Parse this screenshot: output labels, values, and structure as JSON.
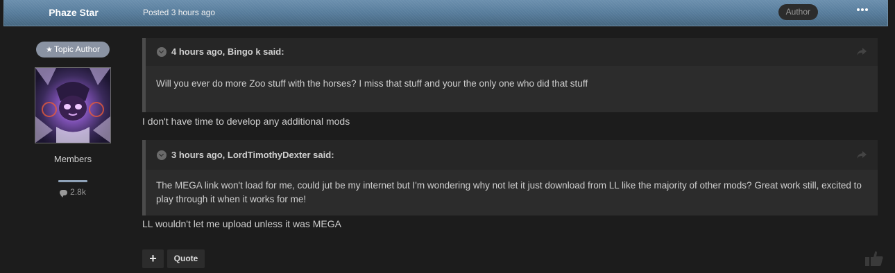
{
  "header": {
    "author_name": "Phaze Star",
    "posted": "Posted 3 hours ago",
    "author_badge": "Author",
    "more_icon": "ellipsis-icon"
  },
  "sidebar": {
    "topic_author_badge": "Topic Author",
    "badge_icon": "star-icon",
    "avatar_icon": "avatar-image",
    "group": "Members",
    "post_count": "2.8k",
    "post_count_icon": "comment-icon"
  },
  "quotes": [
    {
      "title": "4 hours ago, Bingo k said:",
      "body": "Will you ever do more Zoo stuff with the horses? I miss that stuff and your the only one who did that stuff"
    },
    {
      "title": "3 hours ago, LordTimothyDexter said:",
      "body": "The MEGA link won't load for me, could jut be my internet but I'm wondering why not let it just download from LL like the majority of other mods? Great work still, excited to play through it when it works for me!"
    }
  ],
  "replies": [
    "I don't have time to develop any additional mods",
    "LL wouldn't let me upload unless it was MEGA"
  ],
  "actions": {
    "plus_label": "+",
    "quote_label": "Quote",
    "like_icon": "thumbs-up-icon"
  },
  "colors": {
    "header": "#557a99",
    "background": "#1c1c1c",
    "quote_bg": "#2c2c2c",
    "topic_author_badge": "#8a93a3"
  }
}
